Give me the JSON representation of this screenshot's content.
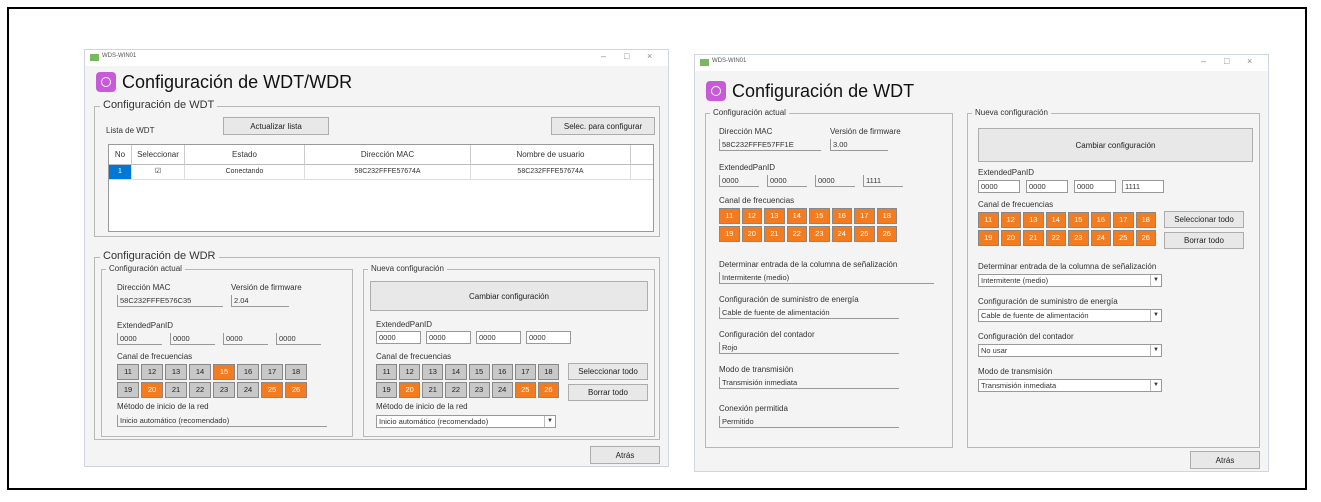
{
  "left": {
    "window_title": "WDS-WIN01",
    "header_title": "Configuración de WDT/WDR",
    "wdt_group": {
      "title": "Configuración de WDT",
      "list_label": "Lista de WDT",
      "refresh_button": "Actualizar lista",
      "select_button": "Selec. para configurar",
      "columns": [
        "No",
        "Seleccionar",
        "Estado",
        "Dirección MAC",
        "Nombre de usuario"
      ],
      "rows": [
        {
          "no": "1",
          "selected": "☑",
          "status": "Conectando",
          "mac": "58C232FFFE57674A",
          "user": "58C232FFFE57674A"
        }
      ]
    },
    "wdr_group": {
      "title": "Configuración de WDR",
      "current": {
        "title": "Configuración actual",
        "mac_label": "Dirección MAC",
        "mac_value": "58C232FFFE576C35",
        "fw_label": "Versión de firmware",
        "fw_value": "2.04",
        "panid_label": "ExtendedPanID",
        "panid": [
          "0000",
          "0000",
          "0000",
          "0000"
        ],
        "channel_label": "Canal de frecuencias",
        "channels": [
          "11",
          "12",
          "13",
          "14",
          "15",
          "16",
          "17",
          "18",
          "19",
          "20",
          "21",
          "22",
          "23",
          "24",
          "25",
          "26"
        ],
        "channels_on": [
          "15",
          "20",
          "25",
          "26"
        ],
        "method_label": "Método de inicio de la red",
        "method_value": "Inicio automático (recomendado)"
      },
      "new": {
        "title": "Nueva configuración",
        "change_button": "Cambiar configuración",
        "panid_label": "ExtendedPanID",
        "panid": [
          "0000",
          "0000",
          "0000",
          "0000"
        ],
        "channel_label": "Canal de frecuencias",
        "channels": [
          "11",
          "12",
          "13",
          "14",
          "15",
          "16",
          "17",
          "18",
          "19",
          "20",
          "21",
          "22",
          "23",
          "24",
          "25",
          "26"
        ],
        "channels_on": [
          "20",
          "25",
          "26"
        ],
        "select_all": "Seleccionar todo",
        "clear_all": "Borrar todo",
        "method_label": "Método de inicio de la red",
        "method_value": "Inicio automático (recomendado)"
      }
    },
    "back_button": "Atrás"
  },
  "right": {
    "window_title": "WDS-WIN01",
    "header_title": "Configuración de WDT",
    "current": {
      "title": "Configuración actual",
      "mac_label": "Dirección MAC",
      "mac_value": "58C232FFFE57FF1E",
      "fw_label": "Versión de firmware",
      "fw_value": "3.00",
      "panid_label": "ExtendedPanID",
      "panid": [
        "0000",
        "0000",
        "0000",
        "1111"
      ],
      "channel_label": "Canal de frecuencias",
      "channels": [
        "11",
        "12",
        "13",
        "14",
        "15",
        "16",
        "17",
        "18",
        "19",
        "20",
        "21",
        "22",
        "23",
        "24",
        "25",
        "26"
      ],
      "channels_on": [
        "11",
        "12",
        "13",
        "14",
        "15",
        "16",
        "17",
        "18",
        "19",
        "20",
        "21",
        "22",
        "23",
        "24",
        "25",
        "26"
      ],
      "signal_label": "Determinar entrada de la columna de señalización",
      "signal_value": "Intermitente (medio)",
      "power_label": "Configuración de suministro de energía",
      "power_value": "Cable de fuente de alimentación",
      "counter_label": "Configuración del contador",
      "counter_value": "Rojo",
      "tx_label": "Modo de transmisión",
      "tx_value": "Transmisión inmediata",
      "conn_label": "Conexión permitida",
      "conn_value": "Permitido"
    },
    "new": {
      "title": "Nueva configuración",
      "change_button": "Cambiar configuración",
      "panid_label": "ExtendedPanID",
      "panid": [
        "0000",
        "0000",
        "0000",
        "1111"
      ],
      "channel_label": "Canal de frecuencias",
      "channels": [
        "11",
        "12",
        "13",
        "14",
        "15",
        "16",
        "17",
        "18",
        "19",
        "20",
        "21",
        "22",
        "23",
        "24",
        "25",
        "26"
      ],
      "channels_on": [
        "11",
        "12",
        "13",
        "14",
        "15",
        "16",
        "17",
        "18",
        "19",
        "20",
        "21",
        "22",
        "23",
        "24",
        "25",
        "26"
      ],
      "select_all": "Seleccionar todo",
      "clear_all": "Borrar todo",
      "signal_label": "Determinar entrada de la columna de señalización",
      "signal_value": "Intermitente (medio)",
      "power_label": "Configuración de suministro de energía",
      "power_value": "Cable de fuente de alimentación",
      "counter_label": "Configuración del contador",
      "counter_value": "No usar",
      "tx_label": "Modo de transmisión",
      "tx_value": "Transmisión inmediata"
    },
    "back_button": "Atrás"
  },
  "colors": {
    "channel_on": "#f47c20",
    "channel_off": "#c8c8c8",
    "header_icon": "#c75ad6"
  }
}
